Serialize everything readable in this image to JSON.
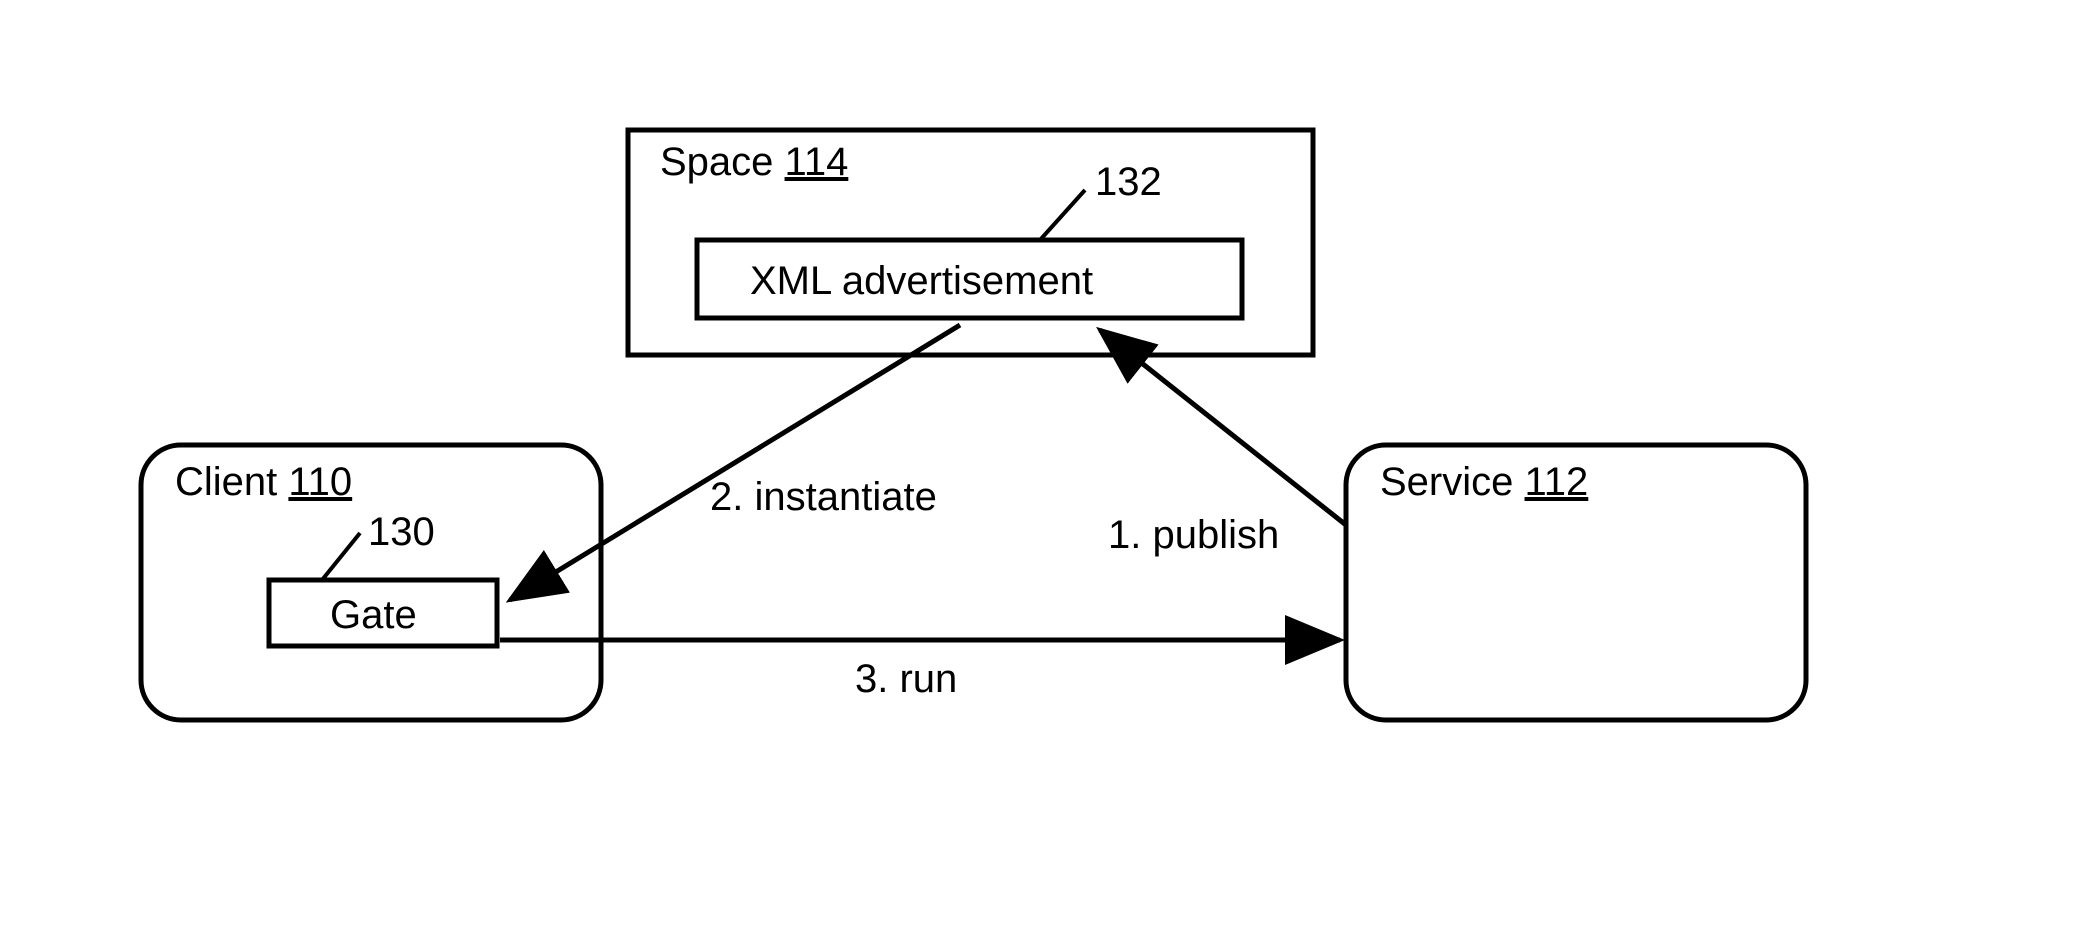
{
  "space": {
    "label": "Space",
    "ref": "114"
  },
  "advert": {
    "label": "XML advertisement",
    "ref": "132"
  },
  "client": {
    "label": "Client",
    "ref": "110"
  },
  "gate": {
    "label": "Gate",
    "ref": "130"
  },
  "service": {
    "label": "Service",
    "ref": "112"
  },
  "arrows": {
    "publish": "1. publish",
    "instantiate": "2. instantiate",
    "run": "3. run"
  }
}
